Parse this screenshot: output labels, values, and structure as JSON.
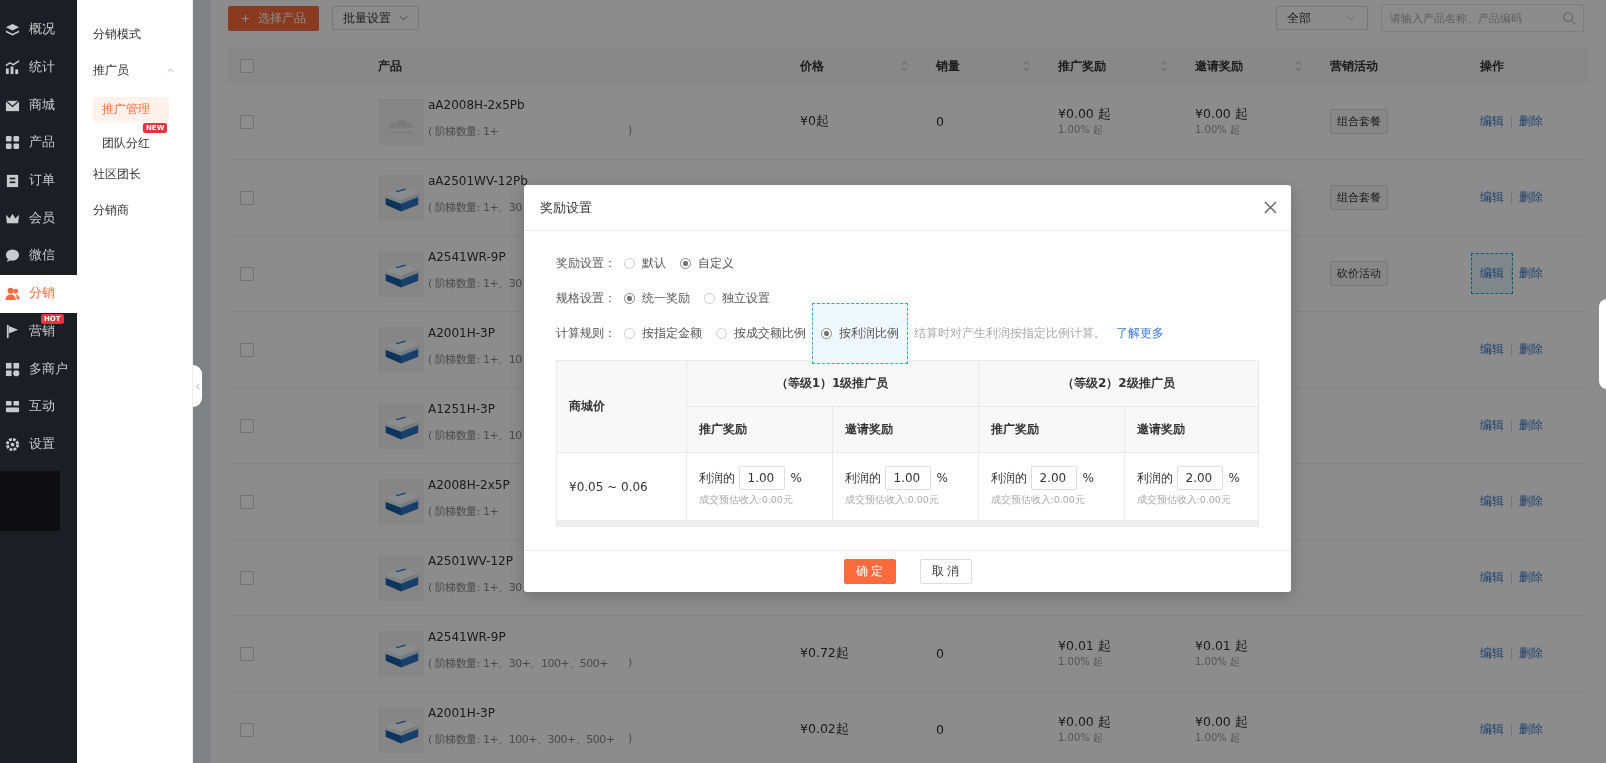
{
  "sidebar": {
    "items": [
      {
        "label": "概况",
        "selected": false
      },
      {
        "label": "统计",
        "selected": false
      },
      {
        "label": "商城",
        "selected": false
      },
      {
        "label": "产品",
        "selected": false
      },
      {
        "label": "订单",
        "selected": false
      },
      {
        "label": "会员",
        "selected": false
      },
      {
        "label": "微信",
        "selected": false
      },
      {
        "label": "分销",
        "selected": true
      },
      {
        "label": "营销",
        "selected": false,
        "badge": "HOT"
      },
      {
        "label": "多商户",
        "selected": false
      },
      {
        "label": "互动",
        "selected": false
      },
      {
        "label": "设置",
        "selected": false
      }
    ]
  },
  "subnav": {
    "items": [
      {
        "label": "分销模式",
        "selected": false
      },
      {
        "label": "推广员",
        "selected": false,
        "expanded": true,
        "children": [
          {
            "label": "推广管理",
            "selected": true
          },
          {
            "label": "团队分红",
            "selected": false,
            "badge": "NEW"
          }
        ]
      },
      {
        "label": "社区团长",
        "selected": false
      },
      {
        "label": "分销商",
        "selected": false
      }
    ]
  },
  "toolbar": {
    "add_button": "选择产品",
    "batch_button": "批量设置",
    "filter": {
      "value": "全部"
    },
    "search": {
      "placeholder": "请输入产品名称、产品编码"
    }
  },
  "table": {
    "select_all_checked": false,
    "columns": [
      {
        "label": "产品",
        "sortable": false
      },
      {
        "label": "价格",
        "sortable": true
      },
      {
        "label": "销量",
        "sortable": true
      },
      {
        "label": "推广奖励",
        "sortable": true
      },
      {
        "label": "邀请奖励",
        "sortable": true
      },
      {
        "label": "营销活动",
        "sortable": false
      },
      {
        "label": "操作",
        "sortable": false
      }
    ],
    "rows": [
      {
        "checked": false,
        "kind": "placeholder",
        "name": "aA2008H-2x5Pb",
        "tiers": "( 阶梯数量: 1+",
        "tiers_close": ")",
        "price": "¥0起",
        "sales": "0",
        "promo": {
          "amount": "¥0.00 起",
          "rate": "1.00% 起"
        },
        "invite": {
          "amount": "¥0.00 起",
          "rate": "1.00% 起"
        },
        "activity": "组合套餐",
        "actions": [
          "编辑",
          "删除"
        ],
        "edit_focused": false
      },
      {
        "checked": false,
        "name": "aA2501WV-12Pb",
        "tiers": "( 阶梯数量: 1+、30",
        "activity": "组合套餐",
        "actions": [
          "编辑",
          "删除"
        ],
        "edit_focused": false
      },
      {
        "checked": false,
        "name": "A2541WR-9P",
        "tiers": "( 阶梯数量: 1+、30",
        "activity": "砍价活动",
        "actions": [
          "编辑",
          "删除"
        ],
        "edit_focused": true
      },
      {
        "checked": false,
        "name": "A2001H-3P",
        "tiers": "( 阶梯数量: 1+、10",
        "actions": [
          "编辑",
          "删除"
        ],
        "edit_focused": false
      },
      {
        "checked": false,
        "name": "A1251H-3P",
        "tiers": "( 阶梯数量: 1+、10",
        "actions": [
          "编辑",
          "删除"
        ],
        "edit_focused": false
      },
      {
        "checked": false,
        "name": "A2008H-2x5P",
        "tiers": "( 阶梯数量: 1+",
        "actions": [
          "编辑",
          "删除"
        ],
        "edit_focused": false
      },
      {
        "checked": false,
        "name": "A2501WV-12P",
        "tiers": "( 阶梯数量: 1+、30",
        "actions": [
          "编辑",
          "删除"
        ],
        "edit_focused": false
      },
      {
        "checked": false,
        "name": "A2541WR-9P",
        "tiers": "( 阶梯数量: 1+、30+、100+、500+",
        "tiers_close": ")",
        "price": "¥0.72起",
        "sales": "0",
        "promo": {
          "amount": "¥0.01 起",
          "rate": "1.00% 起"
        },
        "invite": {
          "amount": "¥0.01 起",
          "rate": "1.00% 起"
        },
        "actions": [
          "编辑",
          "删除"
        ],
        "edit_focused": false
      },
      {
        "checked": false,
        "name": "A2001H-3P",
        "tiers": "( 阶梯数量: 1+、100+、300+、500+",
        "tiers_close": ")",
        "price": "¥0.02起",
        "sales": "0",
        "promo": {
          "amount": "¥0.00 起",
          "rate": "1.00% 起"
        },
        "invite": {
          "amount": "¥0.00 起",
          "rate": "1.00% 起"
        },
        "actions": [
          "编辑",
          "删除"
        ],
        "edit_focused": false
      }
    ]
  },
  "dialog": {
    "title": "奖励设置",
    "settings": [
      {
        "label": "奖励设置：",
        "options": [
          {
            "label": "默认",
            "selected": false,
            "focused": false
          },
          {
            "label": "自定义",
            "selected": true,
            "focused": false
          }
        ]
      },
      {
        "label": "规格设置：",
        "options": [
          {
            "label": "统一奖励",
            "selected": true,
            "focused": false
          },
          {
            "label": "独立设置",
            "selected": false,
            "focused": false
          }
        ]
      },
      {
        "label": "计算规则：",
        "options": [
          {
            "label": "按指定金额",
            "selected": false,
            "focused": false
          },
          {
            "label": "按成交额比例",
            "selected": false,
            "focused": false
          },
          {
            "label": "按利润比例",
            "selected": true,
            "focused": true
          }
        ],
        "hint": "结算时对产生利润按指定比例计算。",
        "link": "了解更多"
      }
    ],
    "table": {
      "price_header": "商城价",
      "price": "¥0.05 ~ 0.06",
      "levels": [
        {
          "title": "（等级1）1级推广员",
          "columns": [
            "推广奖励",
            "邀请奖励"
          ],
          "cells": [
            {
              "prefix": "利润的",
              "value": "1.00",
              "unit": "%",
              "note": "成交预估收入:0.00元"
            },
            {
              "prefix": "利润的",
              "value": "1.00",
              "unit": "%",
              "note": "成交预估收入:0.00元"
            }
          ]
        },
        {
          "title": "（等级2）2级推广员",
          "columns": [
            "推广奖励",
            "邀请奖励"
          ],
          "cells": [
            {
              "prefix": "利润的",
              "value": "2.00",
              "unit": "%",
              "note": "成交预估收入:0.00元"
            },
            {
              "prefix": "利润的",
              "value": "2.00",
              "unit": "%",
              "note": "成交预估收入:0.00元"
            }
          ]
        }
      ]
    },
    "buttons": [
      {
        "label": "确 定",
        "kind": "primary"
      },
      {
        "label": "取 消",
        "kind": "default"
      }
    ]
  }
}
